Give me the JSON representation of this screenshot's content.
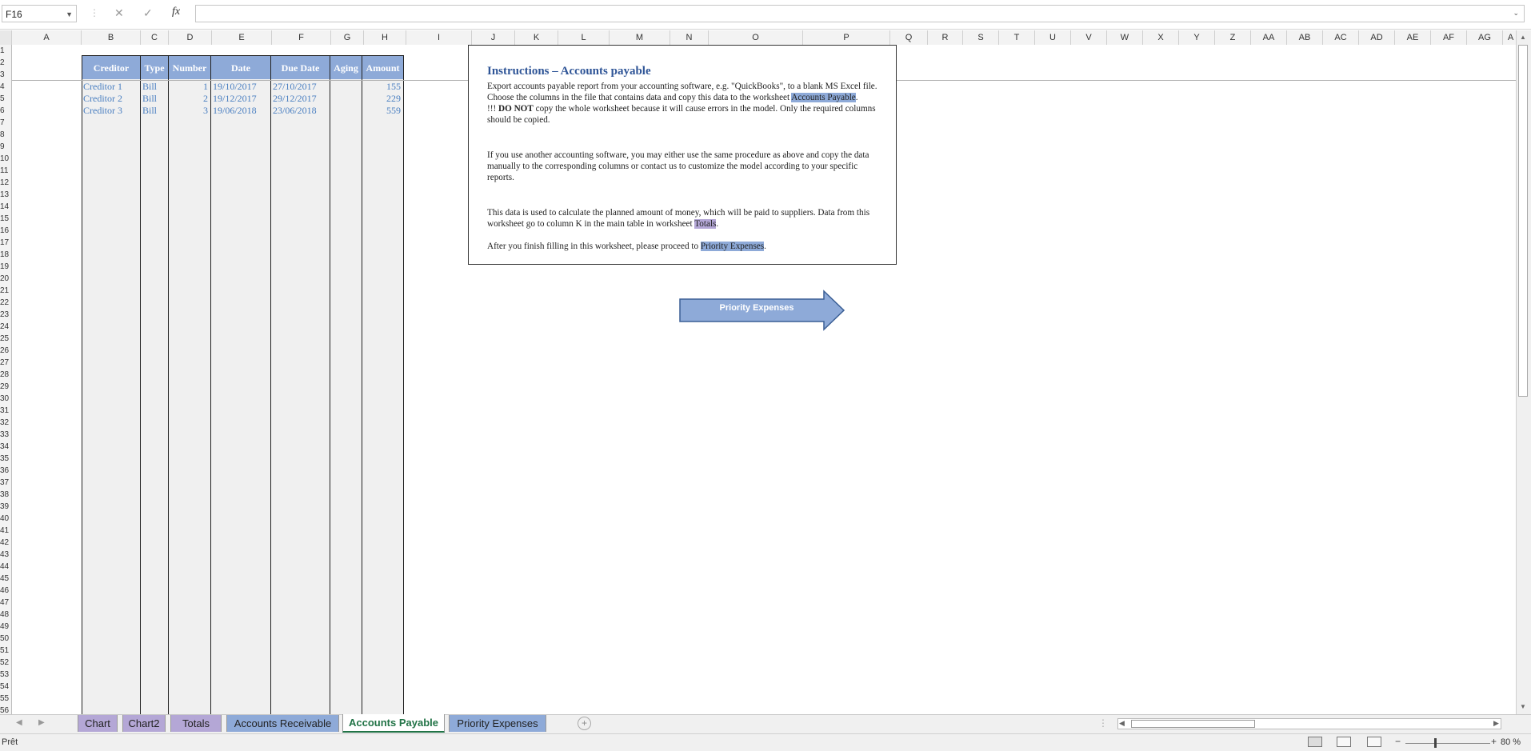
{
  "formula_bar": {
    "name_box": "F16",
    "cancel_glyph": "✕",
    "enter_glyph": "✓",
    "fx_label": "fx",
    "formula": ""
  },
  "columns": [
    "A",
    "B",
    "C",
    "D",
    "E",
    "F",
    "G",
    "H",
    "I",
    "J",
    "K",
    "L",
    "M",
    "N",
    "O",
    "P",
    "Q",
    "R",
    "S",
    "T",
    "U",
    "V",
    "W",
    "X",
    "Y",
    "Z",
    "AA",
    "AB",
    "AC",
    "AD",
    "AE",
    "AF",
    "AG",
    "A"
  ],
  "rows": [
    "1",
    "2",
    "3",
    "4",
    "5",
    "6",
    "7",
    "8",
    "9",
    "10",
    "11",
    "12",
    "13",
    "14",
    "15",
    "16",
    "17",
    "18",
    "19",
    "20",
    "21",
    "22",
    "23",
    "24",
    "25",
    "26",
    "27",
    "28",
    "29",
    "30",
    "31",
    "32",
    "33",
    "34",
    "35",
    "36",
    "37",
    "38",
    "39",
    "40",
    "41",
    "42",
    "43",
    "44",
    "45",
    "46",
    "47",
    "48",
    "49",
    "50",
    "51",
    "52",
    "53",
    "54",
    "55",
    "56"
  ],
  "table": {
    "headers": [
      "Creditor",
      "Type",
      "Number",
      "Date",
      "Due Date",
      "Aging",
      "Amount"
    ],
    "rows": [
      [
        "Creditor 1",
        "Bill",
        "1",
        "19/10/2017",
        "27/10/2017",
        "",
        "155"
      ],
      [
        "Creditor 2",
        "Bill",
        "2",
        "19/12/2017",
        "29/12/2017",
        "",
        "229"
      ],
      [
        "Creditor 3",
        "Bill",
        "3",
        "19/06/2018",
        "23/06/2018",
        "",
        "559"
      ]
    ]
  },
  "instructions": {
    "title": "Instructions – Accounts payable",
    "p1_a": "Export accounts payable report from your accounting software, e.g. \"QuickBooks\", to a blank MS Excel file. Choose the columns in the file that contains data and copy this data to the worksheet ",
    "p1_link": "Accounts Payable",
    "p1_end": ".",
    "p2_prefix": "!!! ",
    "p2_bold": "DO NOT",
    "p2_rest": " copy the whole worksheet because it will cause errors in the model. Only the required columns should be copied.",
    "p3": "If you use another accounting software, you may either use the same procedure as above and copy the data manually to the corresponding columns or contact us to customize the model according to your specific reports.",
    "p4_a": "This data is used to calculate the planned amount of money, which will be paid to suppliers. Data from this worksheet go to column K in the main table in worksheet ",
    "p4_link": "Totals",
    "p4_end": ".",
    "p5_a": "After you finish filling in this worksheet, please proceed to ",
    "p5_link": "Priority Expenses",
    "p5_end": "."
  },
  "arrow_button": {
    "label": "Priority Expenses"
  },
  "sheet_tabs": [
    {
      "label": "Chart",
      "color": "#b4a7d6"
    },
    {
      "label": "Chart2",
      "color": "#b4a7d6"
    },
    {
      "label": "Totals",
      "color": "#b4a7d6"
    },
    {
      "label": "Accounts Receivable",
      "color": "#8eaad8"
    },
    {
      "label": "Accounts Payable",
      "color": "#ffffff"
    },
    {
      "label": "Priority Expenses",
      "color": "#8eaad8"
    }
  ],
  "status": {
    "text": "Prêt",
    "zoom": "80 %",
    "zoom_minus": "−",
    "zoom_plus": "+"
  },
  "colors": {
    "header_blue": "#8eaad8",
    "cell_text": "#4a7fc1",
    "title_blue": "#2f5597",
    "active_tab": "#217346"
  }
}
